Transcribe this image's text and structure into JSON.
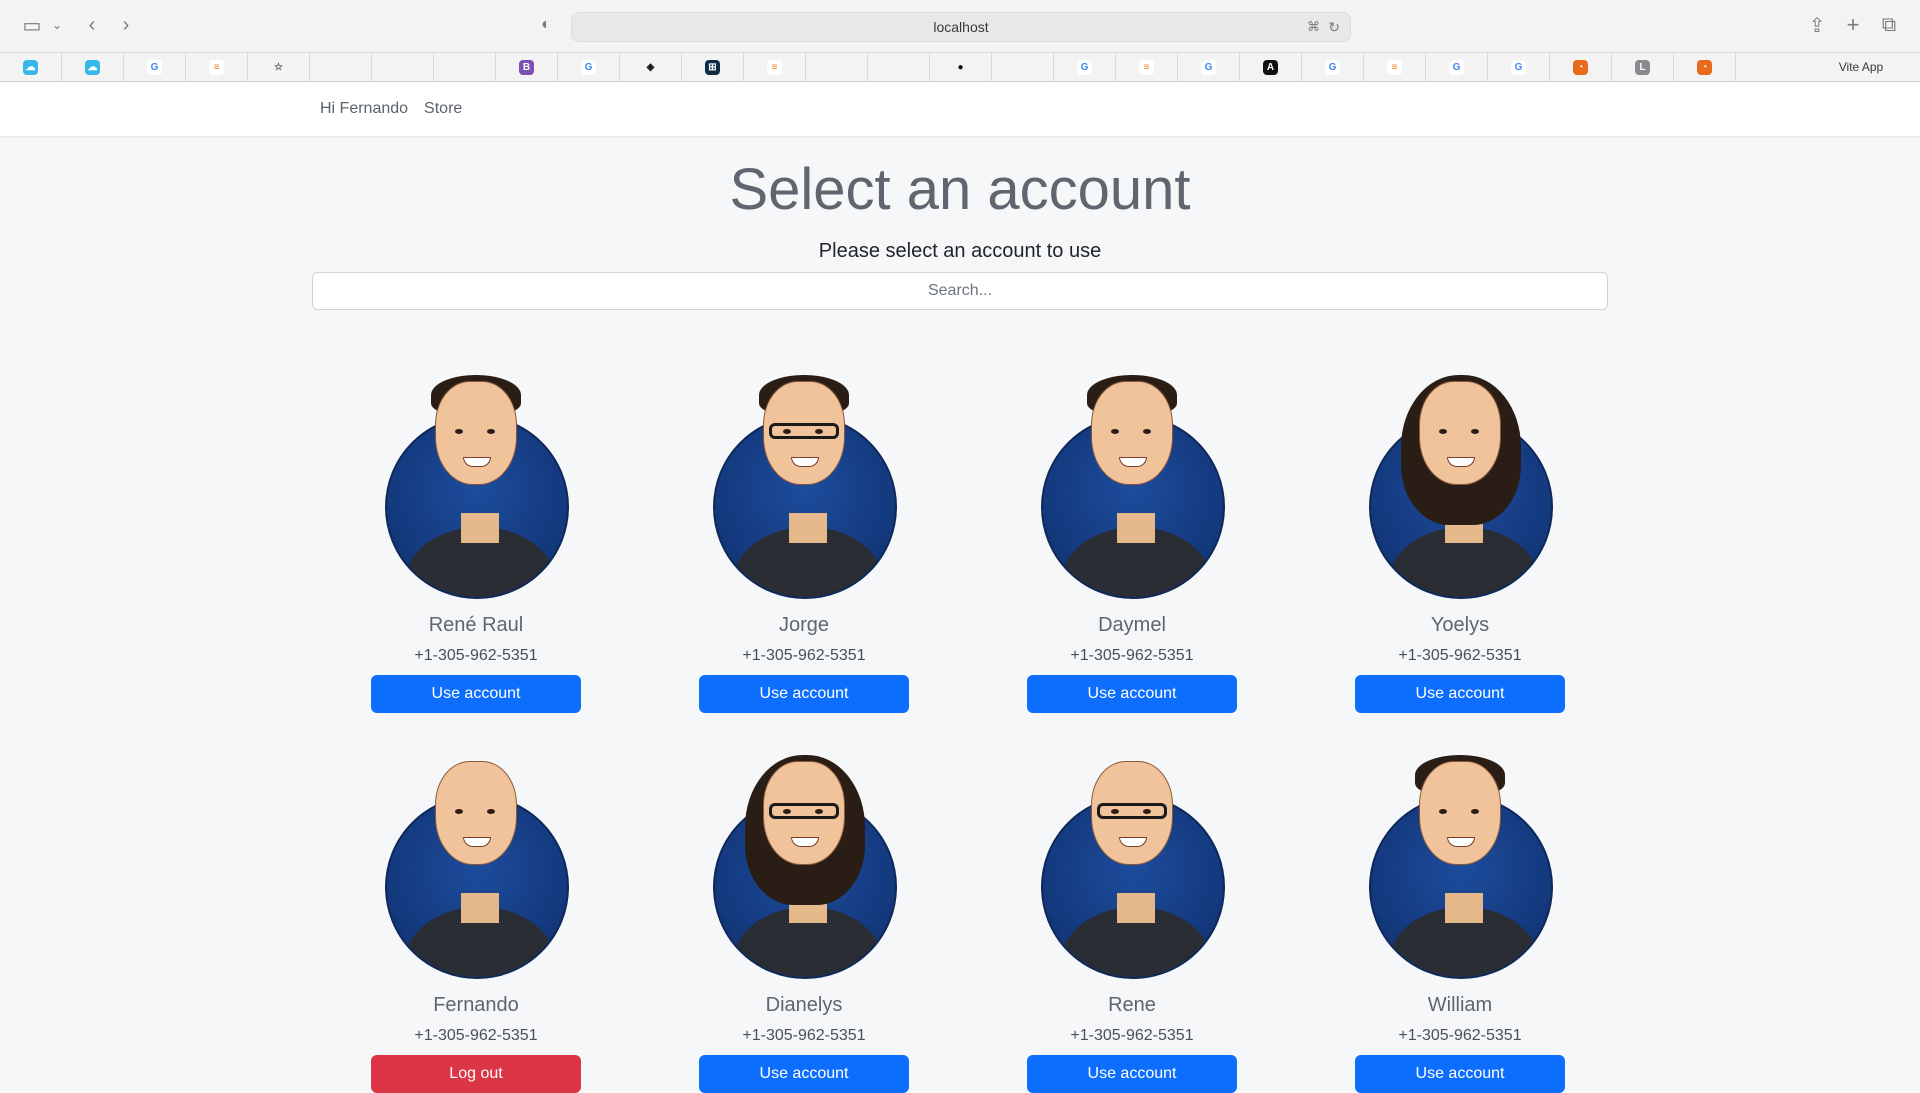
{
  "browser": {
    "url": "localhost",
    "bookmarks_last_label": "Vite App",
    "bookmark_icons": [
      "cloud-icon",
      "cloud-icon",
      "google-icon",
      "stack-icon",
      "star-icon",
      "",
      "",
      "",
      "bootstrap-icon",
      "google-icon",
      "codepen-icon",
      "grid-icon",
      "stack-icon",
      "",
      "",
      "github-icon",
      "",
      "google-icon",
      "stack-icon",
      "google-icon",
      "angular-icon",
      "google-icon",
      "stack-icon",
      "google-icon",
      "google-icon",
      "orange-icon",
      "letter-l-icon",
      "orange-icon"
    ]
  },
  "navbar": {
    "greeting": "Hi Fernando",
    "store": "Store"
  },
  "page": {
    "title": "Select an account",
    "subtitle": "Please select an account to use",
    "search_placeholder": "Search..."
  },
  "accounts": [
    {
      "name": "René Raul",
      "phone": "+1-305-962-5351",
      "action": "Use account",
      "hair": "short",
      "glasses": false
    },
    {
      "name": "Jorge",
      "phone": "+1-305-962-5351",
      "action": "Use account",
      "hair": "short",
      "glasses": true
    },
    {
      "name": "Daymel",
      "phone": "+1-305-962-5351",
      "action": "Use account",
      "hair": "short",
      "glasses": false
    },
    {
      "name": "Yoelys",
      "phone": "+1-305-962-5351",
      "action": "Use account",
      "hair": "long",
      "glasses": false
    },
    {
      "name": "Fernando",
      "phone": "+1-305-962-5351",
      "action": "Log out",
      "hair": "bald",
      "glasses": false
    },
    {
      "name": "Dianelys",
      "phone": "+1-305-962-5351",
      "action": "Use account",
      "hair": "long",
      "glasses": true
    },
    {
      "name": "Rene",
      "phone": "+1-305-962-5351",
      "action": "Use account",
      "hair": "bald",
      "glasses": true
    },
    {
      "name": "William",
      "phone": "+1-305-962-5351",
      "action": "Use account",
      "hair": "short",
      "glasses": false
    }
  ],
  "colors": {
    "primary": "#0d6efd",
    "danger": "#dc3545",
    "avatar_bg": "#143a7f"
  }
}
